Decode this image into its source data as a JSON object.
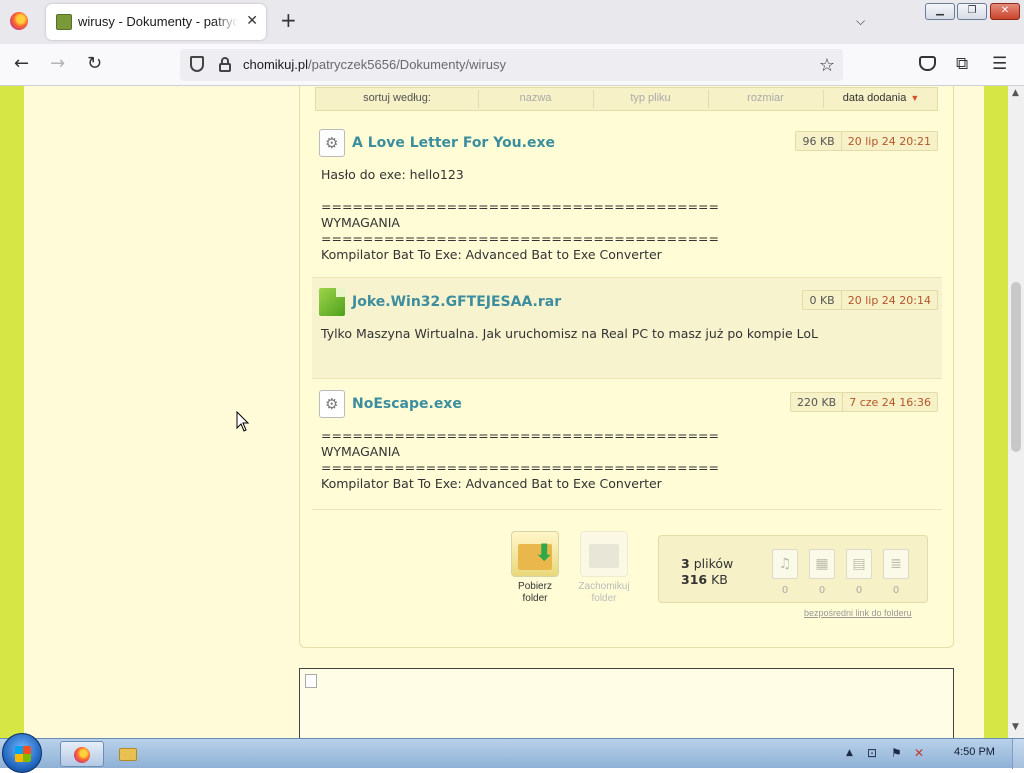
{
  "browser": {
    "tab_title": "wirusy - Dokumenty - patryczek5656",
    "url_host": "chomikuj.pl",
    "url_path": "/patryczek5656/Dokumenty/wirusy"
  },
  "sort": {
    "label": "sortuj według:",
    "name": "nazwa",
    "type": "typ pliku",
    "size": "rozmiar",
    "date": "data dodania",
    "arrow": "▼"
  },
  "files": [
    {
      "name": "A Love Letter For You.exe",
      "size": "96 KB",
      "date": "20 lip 24 20:21",
      "icon": "exe-gear-icon",
      "description": "Hasło do exe: hello123\n\n======================================\nWYMAGANIA\n======================================\nKompilator Bat To Exe: Advanced Bat to Exe Converter"
    },
    {
      "name": "Joke.Win32.GFTEJESAA.rar",
      "size": "0 KB",
      "date": "20 lip 24 20:14",
      "icon": "rar-archive-icon",
      "description": "Tylko Maszyna Wirtualna. Jak uruchomisz na Real PC to masz już po kompie LoL"
    },
    {
      "name": "NoEscape.exe",
      "size": "220 KB",
      "date": "7 cze 24 16:36",
      "icon": "exe-gear-icon",
      "description": "======================================\nWYMAGANIA\n======================================\nKompilator Bat To Exe: Advanced Bat to Exe Converter"
    }
  ],
  "actions": {
    "download_line1": "Pobierz",
    "download_line2": "folder",
    "save_line1": "Zachomikuj",
    "save_line2": "folder"
  },
  "stats": {
    "file_count": "3",
    "file_count_label": "plików",
    "total_size": "316",
    "total_size_unit": "KB",
    "music_count": "0",
    "video_count": "0",
    "image_count": "0",
    "document_count": "0"
  },
  "direct_link": "bezpośredni link do folderu",
  "taskbar": {
    "clock": "4:50 PM"
  },
  "colors": {
    "page_accent": "#d5e645",
    "panel_bg": "#fffcd6",
    "file_link": "#3c8e9e",
    "date_text": "#b4552a"
  }
}
